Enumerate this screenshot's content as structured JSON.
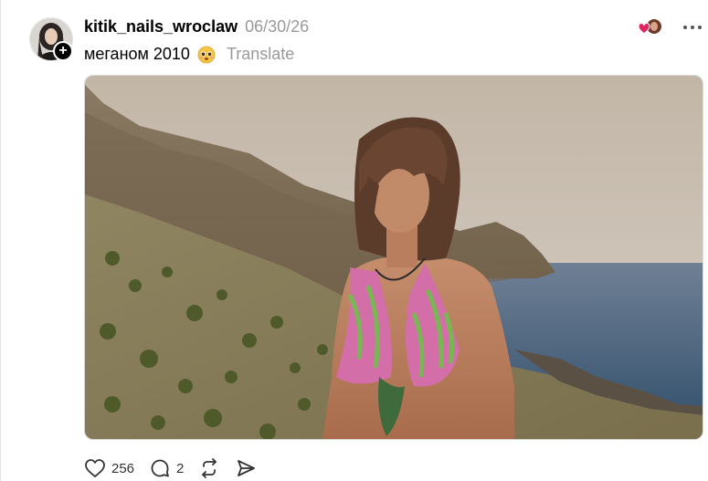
{
  "post": {
    "username": "kitik_nails_wroclaw",
    "timestamp": "06/30/26",
    "caption": "меганом 2010",
    "caption_emoji": "pleading-face-emoji",
    "translate_label": "Translate",
    "likes": "256",
    "replies": "2"
  },
  "icons": {
    "follow": "plus-icon",
    "reactors": "heart-icon",
    "more": "more-icon",
    "like": "heart-icon",
    "reply": "comment-icon",
    "repost": "repost-icon",
    "share": "send-icon"
  },
  "colors": {
    "heart_red": "#e0245e",
    "muted_text": "#999999"
  }
}
